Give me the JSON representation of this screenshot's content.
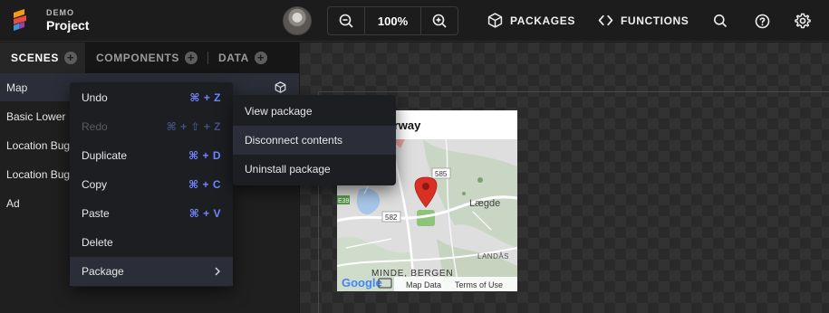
{
  "header": {
    "demo_label": "DEMO",
    "project_name": "Project",
    "zoom_value": "100%",
    "packages_label": "PACKAGES",
    "functions_label": "FUNCTIONS"
  },
  "tabs": [
    {
      "label": "SCENES",
      "active": true
    },
    {
      "label": "COMPONENTS",
      "active": false
    },
    {
      "label": "DATA",
      "active": false
    }
  ],
  "scenes": [
    {
      "label": "Map"
    },
    {
      "label": "Basic Lower"
    },
    {
      "label": "Location Bug"
    },
    {
      "label": "Location Bug"
    },
    {
      "label": "Ad"
    }
  ],
  "context_menu": {
    "items": [
      {
        "label": "Undo",
        "shortcut": "⌘ + Z",
        "disabled": false
      },
      {
        "label": "Redo",
        "shortcut": "⌘ + ⇧ + Z",
        "disabled": true
      },
      {
        "label": "Duplicate",
        "shortcut": "⌘ + D",
        "disabled": false
      },
      {
        "label": "Copy",
        "shortcut": "⌘ + C",
        "disabled": false
      },
      {
        "label": "Paste",
        "shortcut": "⌘ + V",
        "disabled": false
      },
      {
        "label": "Delete",
        "shortcut": "",
        "disabled": false
      },
      {
        "label": "Package",
        "shortcut": "",
        "disabled": false
      }
    ],
    "submenu": [
      {
        "label": "View package"
      },
      {
        "label": "Disconnect contents"
      },
      {
        "label": "Uninstall package"
      }
    ]
  },
  "preview": {
    "title": "rgen, Norway",
    "map_labels": {
      "road_585": "585",
      "road_582": "582",
      "road_e39": "E39",
      "area_lg": "Lægde",
      "area_landas": "LANDÅS",
      "area_minde": "MINDE, BERGEN",
      "attribution_data": "Map Data",
      "attribution_terms": "Terms of Use",
      "google": "Google"
    }
  },
  "colors": {
    "accent": "#6f86ff",
    "marker": "#d93025",
    "selected_row": "#2b2d38"
  }
}
